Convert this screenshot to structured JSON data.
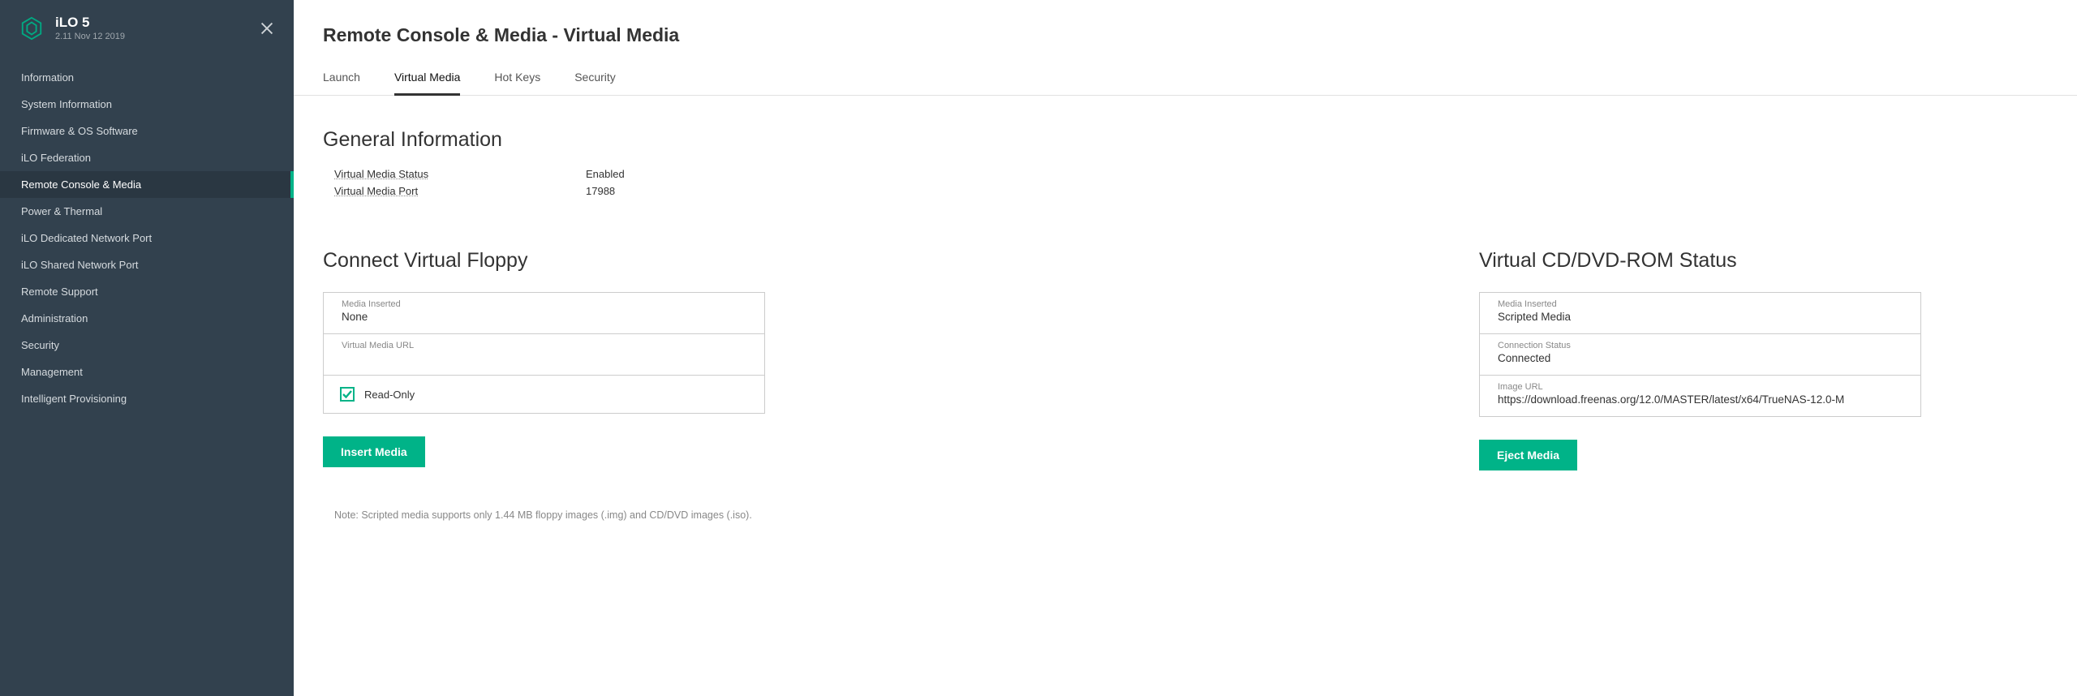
{
  "header": {
    "product": "iLO 5",
    "version": "2.11 Nov 12 2019"
  },
  "sidebar": {
    "items": [
      {
        "label": "Information",
        "active": false
      },
      {
        "label": "System Information",
        "active": false
      },
      {
        "label": "Firmware & OS Software",
        "active": false
      },
      {
        "label": "iLO Federation",
        "active": false
      },
      {
        "label": "Remote Console & Media",
        "active": true
      },
      {
        "label": "Power & Thermal",
        "active": false
      },
      {
        "label": "iLO Dedicated Network Port",
        "active": false
      },
      {
        "label": "iLO Shared Network Port",
        "active": false
      },
      {
        "label": "Remote Support",
        "active": false
      },
      {
        "label": "Administration",
        "active": false
      },
      {
        "label": "Security",
        "active": false
      },
      {
        "label": "Management",
        "active": false
      },
      {
        "label": "Intelligent Provisioning",
        "active": false
      }
    ]
  },
  "page": {
    "title": "Remote Console & Media - Virtual Media",
    "tabs": [
      {
        "label": "Launch",
        "active": false
      },
      {
        "label": "Virtual Media",
        "active": true
      },
      {
        "label": "Hot Keys",
        "active": false
      },
      {
        "label": "Security",
        "active": false
      }
    ]
  },
  "general_info": {
    "title": "General Information",
    "vm_status_label": "Virtual Media Status",
    "vm_status_value": "Enabled",
    "vm_port_label": "Virtual Media Port",
    "vm_port_value": "17988"
  },
  "floppy": {
    "title": "Connect Virtual Floppy",
    "media_inserted_label": "Media Inserted",
    "media_inserted_value": "None",
    "vm_url_label": "Virtual Media URL",
    "vm_url_value": "",
    "readonly_label": "Read-Only",
    "readonly_checked": true,
    "insert_btn": "Insert Media"
  },
  "cdrom": {
    "title": "Virtual CD/DVD-ROM Status",
    "media_inserted_label": "Media Inserted",
    "media_inserted_value": "Scripted Media",
    "conn_status_label": "Connection Status",
    "conn_status_value": "Connected",
    "image_url_label": "Image URL",
    "image_url_value": "https://download.freenas.org/12.0/MASTER/latest/x64/TrueNAS-12.0-M",
    "eject_btn": "Eject Media"
  },
  "note": "Note: Scripted media supports only 1.44 MB floppy images (.img) and CD/DVD images (.iso)."
}
